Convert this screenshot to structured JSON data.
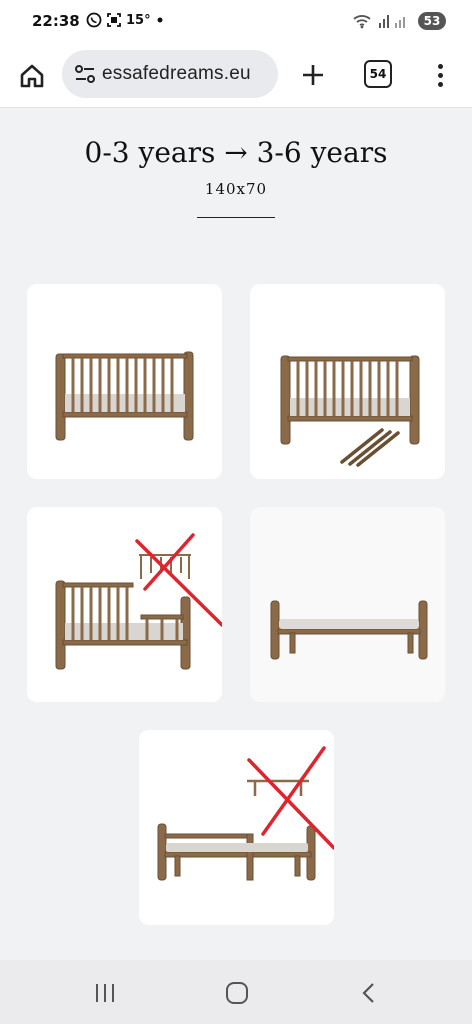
{
  "status_bar": {
    "time": "22:38",
    "temperature": "15°",
    "battery": "53",
    "icons": [
      "whatsapp-icon",
      "screenshot-icon",
      "dot-icon",
      "wifi-icon",
      "signal-icon"
    ]
  },
  "browser": {
    "url": "essafedreams.eu",
    "tab_count": "54",
    "icons": [
      "home-icon",
      "site-settings-icon",
      "new-tab-icon",
      "menu-icon"
    ]
  },
  "page": {
    "heading": "0-3 years → 3-6 years",
    "size": "140x70"
  },
  "cards": [
    {
      "name": "crib-assembled"
    },
    {
      "name": "crib-with-removed-bars"
    },
    {
      "name": "crib-side-panel-removed",
      "crossed": true
    },
    {
      "name": "bench-sofa"
    },
    {
      "name": "junior-bed-extended",
      "crossed": true
    }
  ],
  "nav": {
    "icons": [
      "recent-apps-icon",
      "home-nav-icon",
      "back-icon"
    ]
  },
  "colors": {
    "wood": "#8a6a48",
    "wood_dark": "#6b4f33",
    "mattress": "#d9d6d2",
    "cross": "#e0242d"
  }
}
